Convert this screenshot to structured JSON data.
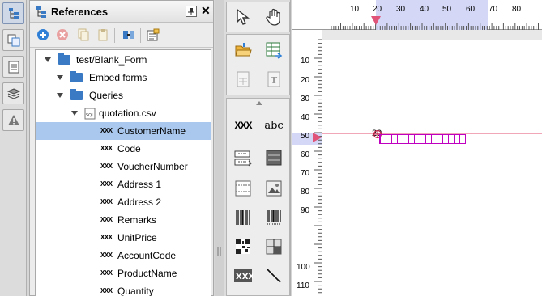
{
  "panel": {
    "title": "References"
  },
  "tree": {
    "root": "test/Blank_Form",
    "embed": "Embed forms",
    "queries": "Queries",
    "csv": "quotation.csv",
    "fields": [
      "CustomerName",
      "Code",
      "VoucherNumber",
      "Address 1",
      "Address 2",
      "Remarks",
      "UnitPrice",
      "AccountCode",
      "ProductName",
      "Quantity"
    ]
  },
  "tools": {
    "text_label": "abc",
    "field_label": "XXX"
  },
  "hruler": {
    "ticks": [
      "10",
      "20",
      "30",
      "40",
      "50",
      "60",
      "70",
      "80"
    ]
  },
  "vruler": {
    "ticks": [
      "10",
      "20",
      "30",
      "40",
      "50",
      "60",
      "70",
      "80",
      "90",
      "100",
      "110"
    ]
  },
  "guide": {
    "marker_label": "20"
  },
  "colors": {
    "accent": "#3a79c3",
    "selection": "#aac8ee",
    "guide": "#e0547a",
    "object": "#c000c0"
  }
}
